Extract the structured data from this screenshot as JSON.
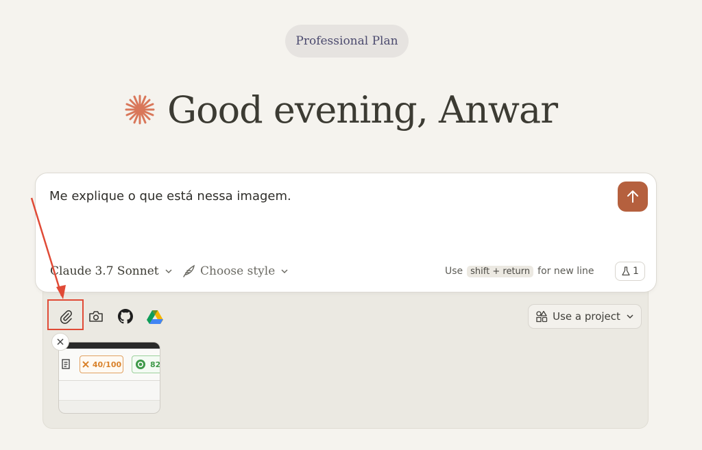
{
  "header": {
    "plan_label": "Professional Plan",
    "greeting": "Good evening, Anwar"
  },
  "composer": {
    "prompt_text": "Me explique o que está nessa imagem.",
    "model_brand": "Claude",
    "model_version": "3.7 Sonnet",
    "style_label": "Choose style",
    "hint_prefix": "Use",
    "hint_shortcut": "shift + return",
    "hint_suffix": "for new line",
    "beta_count": "1",
    "send_icon": "arrow-up-icon"
  },
  "toolbar": {
    "tools": [
      "paperclip-icon",
      "camera-icon",
      "github-icon",
      "google-drive-icon"
    ],
    "project_label": "Use a project"
  },
  "attachment": {
    "score_label": "40/100",
    "score2_label": "82"
  },
  "colors": {
    "background": "#f5f3ee",
    "accent": "#b5603e",
    "spark": "#d9775a",
    "highlight": "#e04a36"
  }
}
